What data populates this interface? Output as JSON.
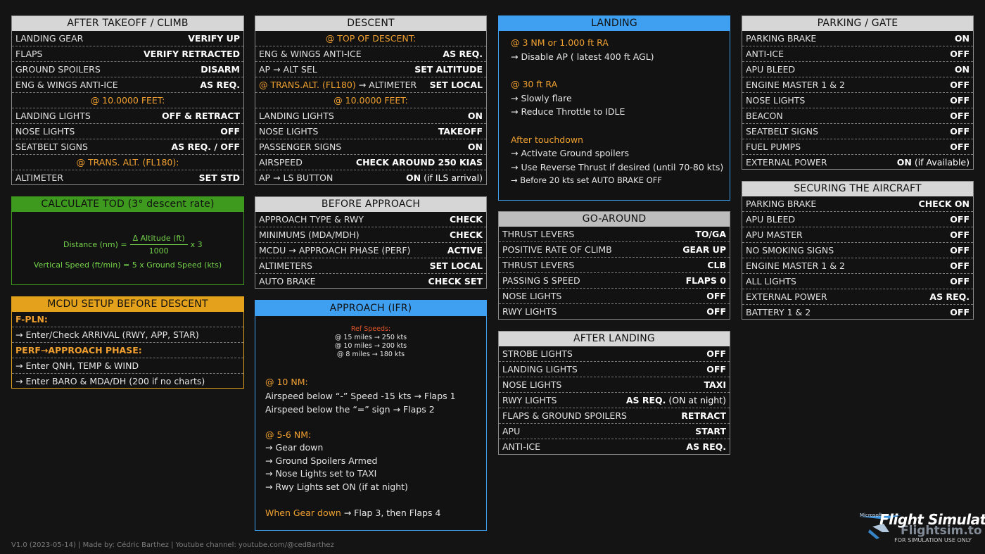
{
  "after_takeoff": {
    "title": "AFTER TAKEOFF / CLIMB",
    "rows": [
      {
        "l": "LANDING GEAR",
        "r": "VERIFY UP"
      },
      {
        "l": "FLAPS",
        "r": "VERIFY RETRACTED"
      },
      {
        "l": "GROUND SPOILERS",
        "r": "DISARM"
      },
      {
        "l": "ENG & WINGS ANTI-ICE",
        "r": "AS REQ."
      },
      {
        "sec": "@ 10.0000 FEET:"
      },
      {
        "l": "LANDING LIGHTS",
        "r": "OFF & RETRACT"
      },
      {
        "l": "NOSE LIGHTS",
        "r": "OFF"
      },
      {
        "l": "SEATBELT SIGNS",
        "r": "AS REQ. / OFF"
      },
      {
        "sec": "@ TRANS. ALT. (FL180):"
      },
      {
        "l": "ALTIMETER",
        "r": "SET STD"
      }
    ]
  },
  "calc_tod": {
    "title": "CALCULATE TOD (3° descent rate)",
    "dist_label": "Distance (nm) =",
    "numerator": "Δ Altitude (ft)",
    "denominator": "1000",
    "multiplier": "x 3",
    "vs": "Vertical Speed (ft/min) = 5 x Ground Speed (kts)"
  },
  "mcdu": {
    "title": "MCDU SETUP BEFORE DESCENT",
    "fpln": "F-PLN:",
    "fpln_item": "→ Enter/Check ARRIVAL (RWY, APP, STAR)",
    "perf": "PERF→APPROACH PHASE:",
    "perf_item1": "→ Enter QNH, TEMP & WIND",
    "perf_item2": "→ Enter BARO & MDA/DH (200 if no charts)"
  },
  "descent": {
    "title": "DESCENT",
    "rows": [
      {
        "sec": "@ TOP OF DESCENT:"
      },
      {
        "l": "ENG & WINGS ANTI-ICE",
        "r": "AS REQ."
      },
      {
        "l": "AP → ALT SEL",
        "r": "SET ALTITUDE"
      },
      {
        "lo": "@ TRANS.ALT. (FL180)",
        "lw": " → ALTIMETER",
        "r": "SET LOCAL"
      },
      {
        "sec": "@ 10.0000 FEET:"
      },
      {
        "l": "LANDING LIGHTS",
        "r": "ON"
      },
      {
        "l": "NOSE LIGHTS",
        "r": "TAKEOFF"
      },
      {
        "l": "PASSENGER SIGNS",
        "r": "ON"
      },
      {
        "l": "AIRSPEED",
        "r": "CHECK AROUND 250 KIAS"
      },
      {
        "l": "AP → LS BUTTON",
        "r": "ON",
        "rn": " (if ILS arrival)"
      }
    ]
  },
  "before_approach": {
    "title": "BEFORE APPROACH",
    "rows": [
      {
        "l": "APPROACH TYPE & RWY",
        "r": "CHECK"
      },
      {
        "l": "MINIMUMS (MDA/MDH)",
        "r": "CHECK"
      },
      {
        "l": "MCDU → APPROACH PHASE (PERF)",
        "r": "ACTIVE"
      },
      {
        "l": "ALTIMETERS",
        "r": "SET LOCAL"
      },
      {
        "l": "AUTO BRAKE",
        "r": "CHECK SET"
      }
    ]
  },
  "approach": {
    "title": "APPROACH (IFR)",
    "ref_title": "Ref Speeds:",
    "ref1": "@ 15 miles → 250 kts",
    "ref2": "@ 10 miles → 200 kts",
    "ref3": "@ 8 miles → 180 kts",
    "nm10": "@ 10 NM:",
    "nm10_1": "Airspeed below “-” Speed -15 kts → Flaps 1",
    "nm10_2": "Airspeed below the “=” sign → Flaps 2",
    "nm56": "@ 5-6 NM:",
    "nm56_1": "→ Gear down",
    "nm56_2": "→ Ground Spoilers Armed",
    "nm56_3": "→ Nose Lights set to TAXI",
    "nm56_4": "→ Rwy Lights set ON (if at night)",
    "gear_o": "When Gear down",
    "gear_w": " → Flap 3, then Flaps 4"
  },
  "landing": {
    "title": "LANDING",
    "s1": "@ 3 NM or 1.000 ft RA",
    "s1_1": "→ Disable AP ( latest 400 ft AGL)",
    "s2": "@ 30 ft RA",
    "s2_1": "→ Slowly flare",
    "s2_2": "→ Reduce Throttle to IDLE",
    "s3": "After touchdown",
    "s3_1": "→ Activate Ground spoilers",
    "s3_2": "→ Use Reverse Thrust if desired (until 70-80 kts)",
    "s3_3": "→ Before 20 kts set AUTO BRAKE OFF"
  },
  "go_around": {
    "title": "GO-AROUND",
    "rows": [
      {
        "l": "THRUST LEVERS",
        "r": "TO/GA"
      },
      {
        "l": "POSITIVE RATE OF CLIMB",
        "r": "GEAR UP"
      },
      {
        "l": "THRUST LEVERS",
        "r": "CLB"
      },
      {
        "l": "PASSING S SPEED",
        "r": "FLAPS 0"
      },
      {
        "l": "NOSE LIGHTS",
        "r": "OFF"
      },
      {
        "l": "RWY LIGHTS",
        "r": "OFF"
      }
    ]
  },
  "after_landing": {
    "title": "AFTER LANDING",
    "rows": [
      {
        "l": "STROBE LIGHTS",
        "r": "OFF"
      },
      {
        "l": "LANDING LIGHTS",
        "r": "OFF"
      },
      {
        "l": "NOSE LIGHTS",
        "r": "TAXI"
      },
      {
        "l": "RWY LIGHTS",
        "r": "AS REQ.",
        "rn": " (ON at night)"
      },
      {
        "l": "FLAPS & GROUND SPOILERS",
        "r": "RETRACT"
      },
      {
        "l": "APU",
        "r": "START"
      },
      {
        "l": "ANTI-ICE",
        "r": "AS REQ."
      }
    ]
  },
  "parking": {
    "title": "PARKING / GATE",
    "rows": [
      {
        "l": "PARKING BRAKE",
        "r": "ON"
      },
      {
        "l": "ANTI-ICE",
        "r": "OFF"
      },
      {
        "l": "APU BLEED",
        "r": "ON"
      },
      {
        "l": "ENGINE MASTER 1 & 2",
        "r": "OFF"
      },
      {
        "l": "NOSE LIGHTS",
        "r": "OFF"
      },
      {
        "l": "BEACON",
        "r": "OFF"
      },
      {
        "l": "SEATBELT SIGNS",
        "r": "OFF"
      },
      {
        "l": "FUEL PUMPS",
        "r": "OFF"
      },
      {
        "l": "EXTERNAL POWER",
        "r": "ON",
        "rn": " (if Available)"
      }
    ]
  },
  "securing": {
    "title": "SECURING THE AIRCRAFT",
    "rows": [
      {
        "l": "PARKING BRAKE",
        "r": "CHECK ON"
      },
      {
        "l": "APU BLEED",
        "r": "OFF"
      },
      {
        "l": "APU MASTER",
        "r": "OFF"
      },
      {
        "l": "NO SMOKING SIGNS",
        "r": "OFF"
      },
      {
        "l": "ENGINE MASTER 1 & 2",
        "r": "OFF"
      },
      {
        "l": "ALL LIGHTS",
        "r": "OFF"
      },
      {
        "l": "EXTERNAL POWER",
        "r": "AS REQ."
      },
      {
        "l": "BATTERY 1 & 2",
        "r": "OFF"
      }
    ]
  },
  "footer": "V1.0 (2023-05-14) | Made by: Cédric Barthez | Youtube channel: youtube.com/@cedBarthez",
  "logo": {
    "brand": "Microsoft",
    "name": "Flight Simulator",
    "site": "Flightsim.to",
    "note": "FOR SIMULATION USE ONLY"
  }
}
